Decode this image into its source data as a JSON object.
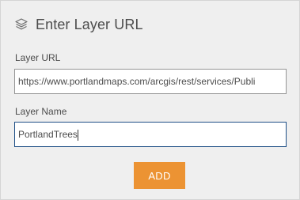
{
  "panel": {
    "title": "Enter Layer URL",
    "title_icon": "layers-icon"
  },
  "fields": {
    "url": {
      "label": "Layer URL",
      "value": "https://www.portlandmaps.com/arcgis/rest/services/Publi"
    },
    "name": {
      "label": "Layer Name",
      "value": "PortlandTrees"
    }
  },
  "actions": {
    "add_label": "ADD"
  },
  "colors": {
    "panel_bg": "#efefef",
    "accent": "#ec9333",
    "focus_border": "#1e4f86",
    "text": "#4c4c4c"
  }
}
